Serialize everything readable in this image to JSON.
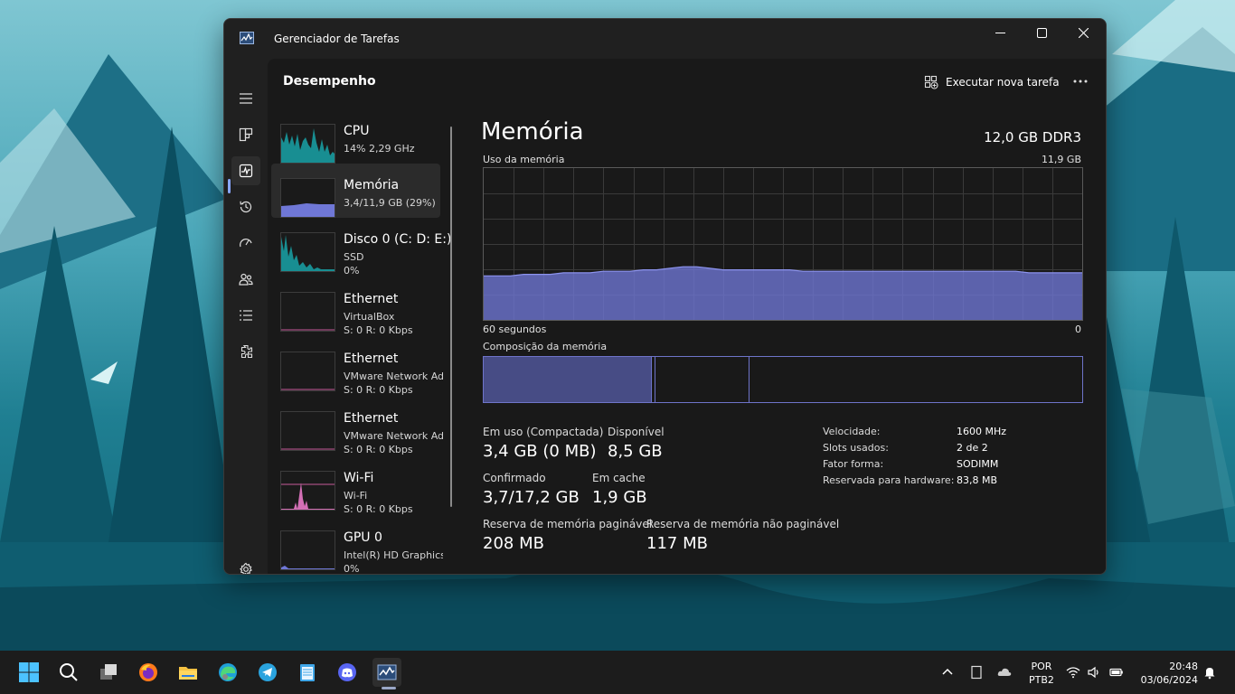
{
  "window": {
    "title": "Gerenciador de Tarefas"
  },
  "header": {
    "title": "Desempenho",
    "run_task_label": "Executar nova tarefa"
  },
  "sidebar": {
    "items": [
      {
        "icon": "hamburger-icon"
      },
      {
        "icon": "processes-icon"
      },
      {
        "icon": "performance-icon"
      },
      {
        "icon": "history-icon"
      },
      {
        "icon": "startup-icon"
      },
      {
        "icon": "users-icon"
      },
      {
        "icon": "details-icon"
      },
      {
        "icon": "services-icon"
      },
      {
        "icon": "settings-icon"
      }
    ]
  },
  "devices": [
    {
      "name": "CPU",
      "line1": "14% 2,29 GHz",
      "line2": ""
    },
    {
      "name": "Memória",
      "line1": "3,4/11,9 GB (29%)",
      "line2": ""
    },
    {
      "name": "Disco 0 (C: D: E:)",
      "line1": "SSD",
      "line2": "0%"
    },
    {
      "name": "Ethernet",
      "line1": "VirtualBox",
      "line2": "S: 0 R: 0 Kbps"
    },
    {
      "name": "Ethernet",
      "line1": "VMware Network Ad",
      "line2": "S: 0 R: 0 Kbps"
    },
    {
      "name": "Ethernet",
      "line1": "VMware Network Ad",
      "line2": "S: 0 R: 0 Kbps"
    },
    {
      "name": "Wi-Fi",
      "line1": "Wi-Fi",
      "line2": "S: 0 R: 0 Kbps"
    },
    {
      "name": "GPU 0",
      "line1": "Intel(R) HD Graphics",
      "line2": "0%"
    }
  ],
  "memory": {
    "title": "Memória",
    "type": "12,0 GB DDR3",
    "usage_label": "Uso da memória",
    "usage_max": "11,9 GB",
    "time_left": "60 segundos",
    "time_right": "0",
    "composition_label": "Composição da memória",
    "usage_history_fraction": [
      0.29,
      0.29,
      0.29,
      0.3,
      0.3,
      0.3,
      0.31,
      0.31,
      0.31,
      0.32,
      0.32,
      0.32,
      0.33,
      0.33,
      0.34,
      0.35,
      0.35,
      0.34,
      0.33,
      0.33,
      0.33,
      0.33,
      0.33,
      0.33,
      0.32,
      0.32,
      0.32,
      0.32,
      0.32,
      0.32,
      0.32,
      0.32,
      0.32,
      0.32,
      0.32,
      0.32,
      0.32,
      0.32,
      0.32,
      0.32,
      0.32,
      0.31,
      0.31,
      0.31,
      0.31,
      0.31
    ],
    "composition": {
      "in_use": 0.28,
      "modified": 0.005,
      "standby": 0.155
    },
    "stats": [
      {
        "label": "Em uso (Compactada)",
        "value": "3,4 GB (0 MB)"
      },
      {
        "label": "Disponível",
        "value": "8,5 GB"
      },
      {
        "label": "Confirmado",
        "value": "3,7/17,2 GB"
      },
      {
        "label": "Em cache",
        "value": "1,9 GB"
      },
      {
        "label": "Reserva de memória paginável",
        "value": "208 MB"
      },
      {
        "label": "Reserva de memória não paginável",
        "value": "117 MB"
      }
    ],
    "props": [
      {
        "k": "Velocidade:",
        "v": "1600 MHz"
      },
      {
        "k": "Slots usados:",
        "v": "2 de 2"
      },
      {
        "k": "Fator forma:",
        "v": "SODIMM"
      },
      {
        "k": "Reservada para hardware:",
        "v": "83,8 MB"
      }
    ]
  },
  "taskbar": {
    "lang_top": "POR",
    "lang_bottom": "PTB2",
    "time": "20:48",
    "date": "03/06/2024"
  },
  "colors": {
    "memory": "#6f77d6",
    "cpu": "#19a3a8",
    "wifi": "#d36fb5",
    "accent": "#8aa7ff"
  }
}
